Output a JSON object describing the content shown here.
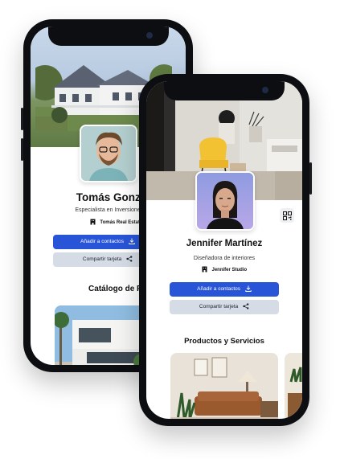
{
  "profile_a": {
    "name": "Tomás Gonzalez",
    "role": "Especialista en Inversiones Inmob",
    "company": "Tomás Real Estate",
    "add_contact_label": "Añadir a contactos",
    "share_label": "Compartir tarjeta",
    "section_title": "Catálogo de Propiedad"
  },
  "profile_b": {
    "name": "Jennifer Martínez",
    "role": "Diseñadora de interiores",
    "company": "Jennifer Studio",
    "add_contact_label": "Añadir a contactos",
    "share_label": "Compartir tarjeta",
    "section_title": "Productos y Servicios"
  },
  "icons": {
    "company": "building-icon",
    "add_contact": "download-icon",
    "share": "share-icon",
    "qr": "qr-code-icon"
  },
  "colors": {
    "primary_button": "#2855d8",
    "secondary_button": "#d6dce6",
    "phone_frame": "#0d0e11"
  }
}
